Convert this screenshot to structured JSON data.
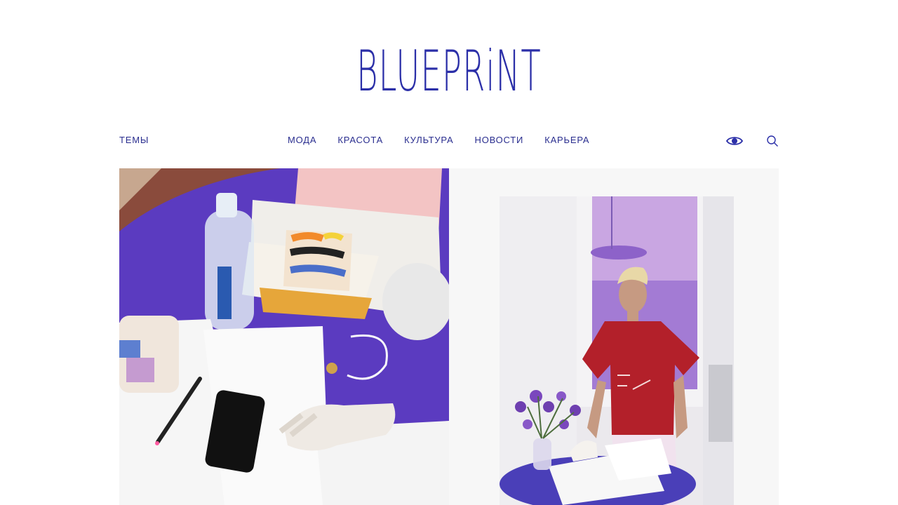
{
  "brand": {
    "logo_text": "BLUEPRiNT"
  },
  "nav": {
    "topics_label": "ТЕМЫ",
    "items": [
      {
        "label": "МОДА"
      },
      {
        "label": "КРАСОТА"
      },
      {
        "label": "КУЛЬТУРА"
      },
      {
        "label": "НОВОСТИ"
      },
      {
        "label": "КАРЬЕРА"
      }
    ]
  },
  "icons": {
    "accessibility": "eye-icon",
    "search": "search-icon"
  },
  "colors": {
    "brand": "#2b2fa8",
    "nav_text": "#2a2e8f",
    "table_purple": "#5f3cc4"
  }
}
